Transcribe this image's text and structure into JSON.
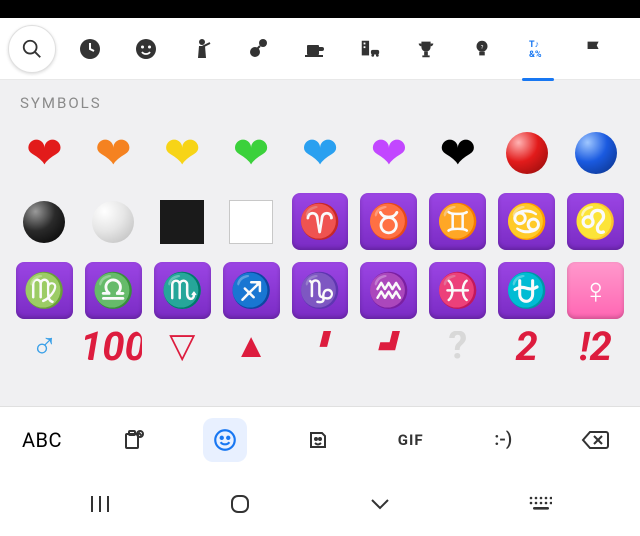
{
  "section_label": "SYMBOLS",
  "abc_label": "ABC",
  "gif_label": "GIF",
  "emoticon_label": ":-)",
  "categories": [
    {
      "name": "search"
    },
    {
      "name": "recent"
    },
    {
      "name": "smileys"
    },
    {
      "name": "people"
    },
    {
      "name": "nature"
    },
    {
      "name": "food"
    },
    {
      "name": "travel"
    },
    {
      "name": "activity"
    },
    {
      "name": "objects"
    },
    {
      "name": "symbols",
      "active": true
    },
    {
      "name": "flags"
    }
  ],
  "zodiac": {
    "aries": "♈",
    "taurus": "♉",
    "gemini": "♊",
    "cancer": "♋",
    "leo": "♌",
    "virgo": "♍",
    "libra": "♎",
    "scorpio": "♏",
    "sagittarius": "♐",
    "capricorn": "♑",
    "aquarius": "♒",
    "pisces": "♓",
    "ophiuchus": "⛎"
  },
  "female_sign": "♀",
  "hundred": "100",
  "question_digits": "2 !2"
}
